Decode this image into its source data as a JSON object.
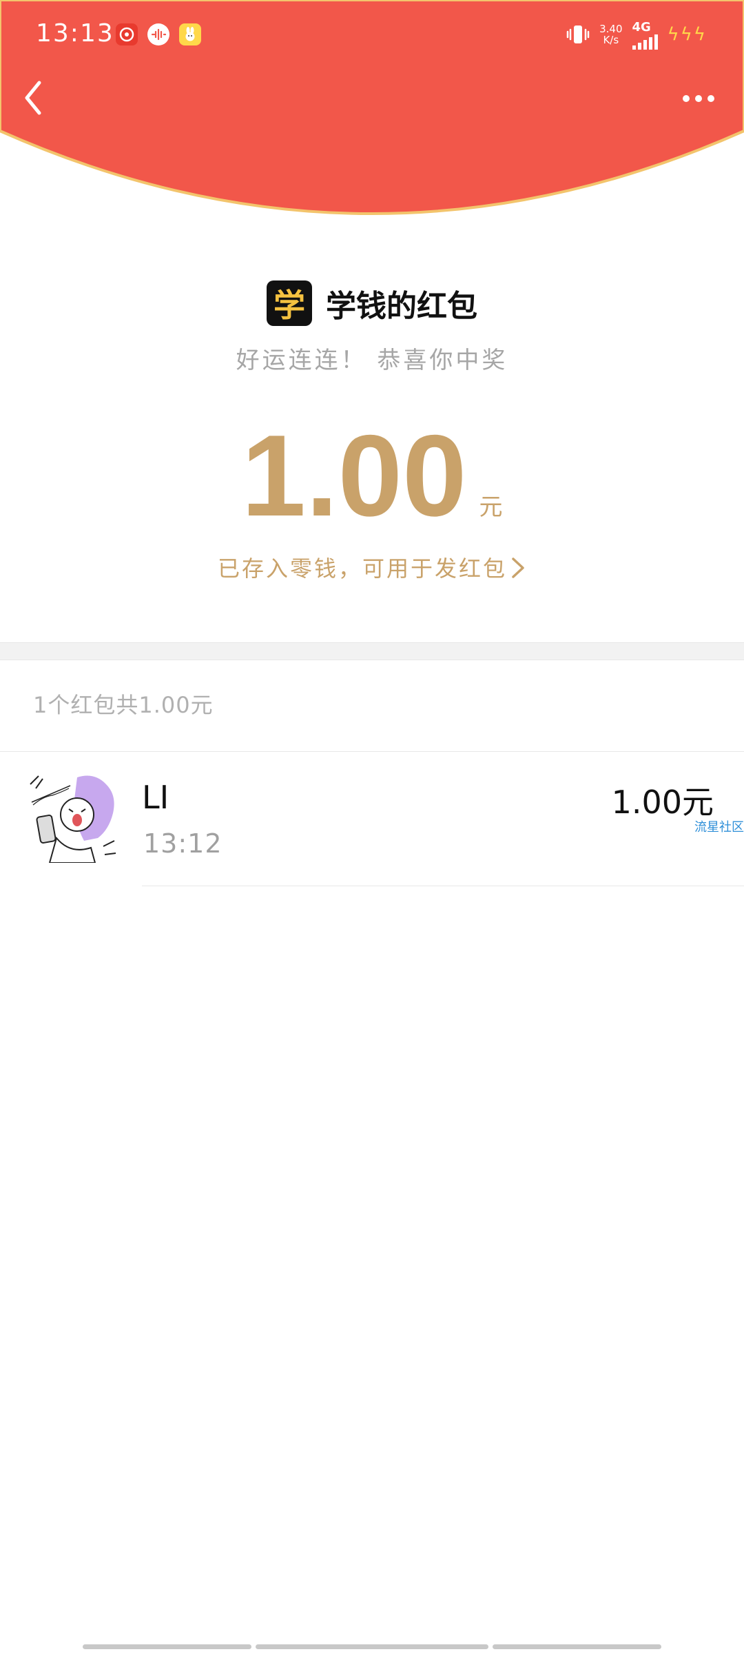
{
  "status_bar": {
    "time": "13:13",
    "net_speed_value": "3.40",
    "net_speed_unit": "K/s",
    "network_type": "4G",
    "notification_icons": [
      "netease-music-icon",
      "voice-app-icon",
      "yellow-bunny-app-icon"
    ]
  },
  "header": {
    "background_color": "#f2574a",
    "back_label": "<",
    "more_label": "more"
  },
  "packet": {
    "sender_avatar_char": "学",
    "sender_name": "学钱的红包",
    "greeting": "好运连连！ 恭喜你中奖",
    "amount": "1.00",
    "amount_unit": "元",
    "deposit_text": "已存入零钱，可用于发红包",
    "accent_color": "#c9a26a"
  },
  "summary": {
    "text": "1个红包共1.00元"
  },
  "records": [
    {
      "name": "LI",
      "time": "13:12",
      "amount": "1.00元",
      "tag": "流星社区"
    }
  ]
}
